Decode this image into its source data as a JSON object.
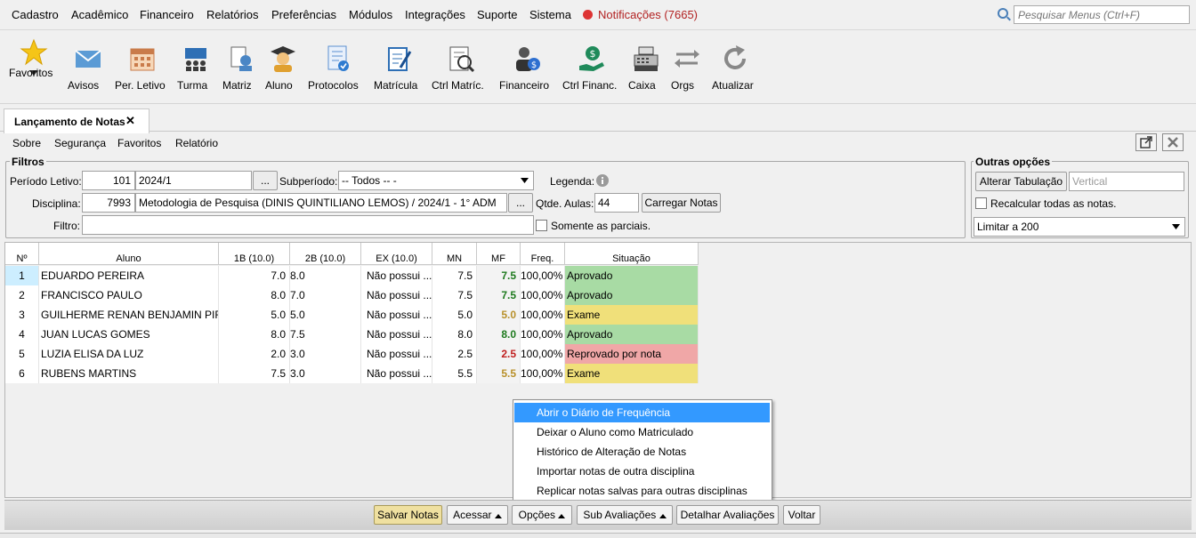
{
  "menubar": {
    "items": [
      "Cadastro",
      "Acadêmico",
      "Financeiro",
      "Relatórios",
      "Preferências",
      "Módulos",
      "Integrações",
      "Suporte",
      "Sistema"
    ],
    "notifications": "Notificações (7665)",
    "search_placeholder": "Pesquisar Menus (Ctrl+F)"
  },
  "toolbar": {
    "items": [
      {
        "label": "Favoritos",
        "icon": "star-icon"
      },
      {
        "label": "Avisos",
        "icon": "envelope-icon"
      },
      {
        "label": "Per. Letivo",
        "icon": "calendar-icon"
      },
      {
        "label": "Turma",
        "icon": "class-icon"
      },
      {
        "label": "Matriz",
        "icon": "matrix-icon"
      },
      {
        "label": "Aluno",
        "icon": "student-icon"
      },
      {
        "label": "Protocolos",
        "icon": "protocol-icon"
      },
      {
        "label": "Matrícula",
        "icon": "enrollment-icon"
      },
      {
        "label": "Ctrl Matríc.",
        "icon": "enrollment-control-icon"
      },
      {
        "label": "Financeiro",
        "icon": "finance-icon"
      },
      {
        "label": "Ctrl Financ.",
        "icon": "finance-control-icon"
      },
      {
        "label": "Caixa",
        "icon": "cash-register-icon"
      },
      {
        "label": "Orgs",
        "icon": "arrows-icon"
      },
      {
        "label": "Atualizar",
        "icon": "refresh-icon"
      }
    ]
  },
  "tab": {
    "title": "Lançamento de Notas",
    "close": "✕"
  },
  "submenu": [
    "Sobre",
    "Segurança",
    "Favoritos",
    "Relatório"
  ],
  "filters": {
    "title": "Filtros",
    "periodo_label": "Período Letivo:",
    "periodo_code": "101",
    "periodo_value": "2024/1",
    "subperiodo_label": "Subperíodo:",
    "subperiodo_value": "-- Todos -- -",
    "legenda_label": "Legenda:",
    "disciplina_label": "Disciplina:",
    "disciplina_code": "7993",
    "disciplina_value": "Metodologia de Pesquisa (DINIS QUINTILIANO LEMOS) / 2024/1 - 1° ADM",
    "qtde_label": "Qtde. Aulas:",
    "qtde_value": "44",
    "carregar": "Carregar Notas",
    "filtro_label": "Filtro:",
    "somente": "Somente as parciais.",
    "ellipsis": "..."
  },
  "outras": {
    "title": "Outras opções",
    "alterar": "Alterar Tabulação",
    "vertical": "Vertical",
    "recalcular": "Recalcular todas as notas.",
    "limitar": "Limitar a 200"
  },
  "table": {
    "headers": [
      "Nº",
      "Aluno",
      "1B (10.0)",
      "2B (10.0)",
      "EX (10.0)",
      "MN",
      "MF",
      "Freq.",
      "Situação"
    ],
    "rows": [
      {
        "n": "1",
        "aluno": "EDUARDO PEREIRA",
        "b1": "7.0",
        "b2": "8.0",
        "ex": "Não possui ...",
        "mn": "7.5",
        "mf": "7.5",
        "freq": "100,00%",
        "sit": "Aprovado",
        "status": "approved"
      },
      {
        "n": "2",
        "aluno": "FRANCISCO PAULO",
        "b1": "8.0",
        "b2": "7.0",
        "ex": "Não possui ...",
        "mn": "7.5",
        "mf": "7.5",
        "freq": "100,00%",
        "sit": "Aprovado",
        "status": "approved"
      },
      {
        "n": "3",
        "aluno": "GUILHERME RENAN BENJAMIN PIR...",
        "b1": "5.0",
        "b2": "5.0",
        "ex": "Não possui ...",
        "mn": "5.0",
        "mf": "5.0",
        "freq": "100,00%",
        "sit": "Exame",
        "status": "exam"
      },
      {
        "n": "4",
        "aluno": "JUAN LUCAS GOMES",
        "b1": "8.0",
        "b2": "7.5",
        "ex": "Não possui ...",
        "mn": "8.0",
        "mf": "8.0",
        "freq": "100,00%",
        "sit": "Aprovado",
        "status": "approved"
      },
      {
        "n": "5",
        "aluno": "LUZIA ELISA DA LUZ",
        "b1": "2.0",
        "b2": "3.0",
        "ex": "Não possui ...",
        "mn": "2.5",
        "mf": "2.5",
        "freq": "100,00%",
        "sit": "Reprovado por nota",
        "status": "failed"
      },
      {
        "n": "6",
        "aluno": "RUBENS MARTINS",
        "b1": "7.5",
        "b2": "3.0",
        "ex": "Não possui ...",
        "mn": "5.5",
        "mf": "5.5",
        "freq": "100,00%",
        "sit": "Exame",
        "status": "exam"
      }
    ]
  },
  "colors": {
    "approved_bg": "#a8dba4",
    "exam_bg": "#f0e07a",
    "failed_bg": "#f0a7a7",
    "approved_fg": "#1e7a1e",
    "exam_fg": "#b8902a",
    "failed_fg": "#c02020",
    "highlight": "#3399ff"
  },
  "context_menu": [
    "Abrir o Diário de Frequência",
    "Deixar o Aluno como Matriculado",
    "Histórico de Alteração de Notas",
    "Importar notas de outra disciplina",
    "Replicar notas salvas para outras disciplinas"
  ],
  "bottom": {
    "salvar": "Salvar Notas",
    "acessar": "Acessar",
    "opcoes": "Opções",
    "sub": "Sub Avaliações",
    "detalhar": "Detalhar Avaliações",
    "voltar": "Voltar"
  }
}
